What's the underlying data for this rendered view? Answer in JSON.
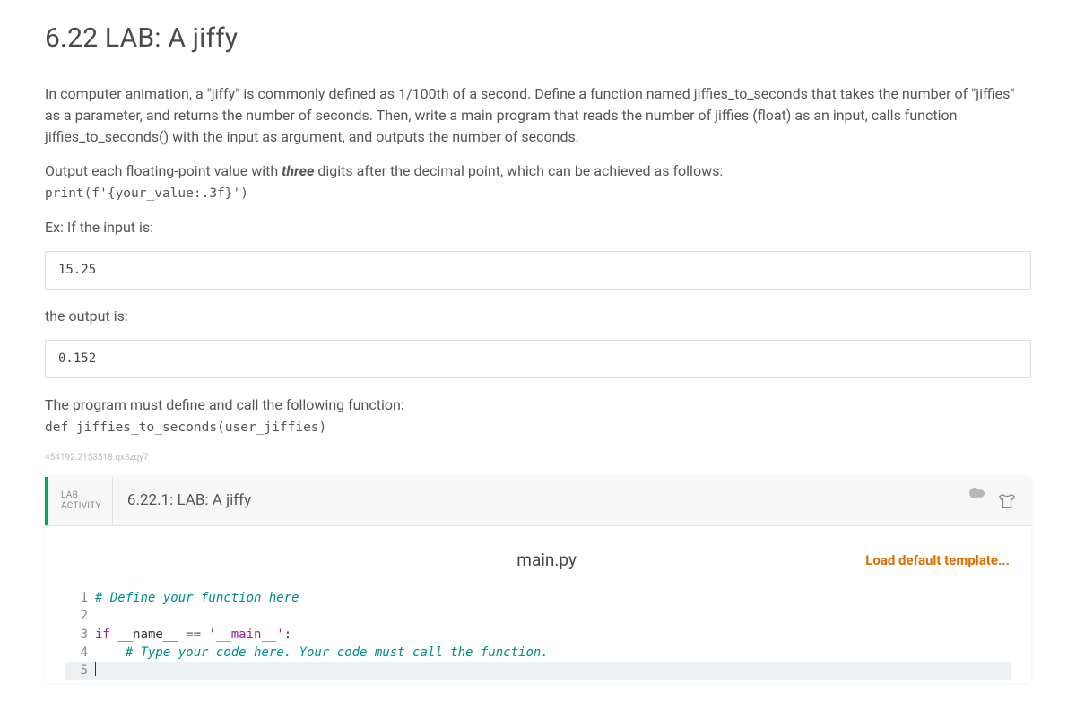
{
  "title": "6.22 LAB: A jiffy",
  "intro_html": "In computer animation, a \"jiffy\" is commonly defined as 1/100th of a second. Define a function named jiffies_to_seconds that takes the number of \"jiffies\" as a parameter, and returns the number of seconds. Then, write a main program that reads the number of jiffies (float) as an input, calls function jiffies_to_seconds() with the input as argument, and outputs the number of seconds.",
  "format_prefix": "Output each floating-point value with ",
  "format_emph": "three",
  "format_suffix": " digits after the decimal point, which can be achieved as follows:",
  "format_code": "print(f'{your_value:.3f}')",
  "ex_input_label": "Ex: If the input is:",
  "ex_input_value": "15.25",
  "ex_output_label": "the output is:",
  "ex_output_value": "0.152",
  "must_define_text": "The program must define and call the following function:",
  "must_define_code": "def jiffies_to_seconds(user_jiffies)",
  "watermark": "454192.2153518.qx3zqy7",
  "lab": {
    "badge_line1": "LAB",
    "badge_line2": "ACTIVITY",
    "title": "6.22.1: LAB: A jiffy"
  },
  "editor": {
    "filename": "main.py",
    "load_template": "Load default template...",
    "lines": {
      "l1_comment": "# Define your function here",
      "l3_kw": "if",
      "l3_name1": " __name__ ",
      "l3_eq": "==",
      "l3_str": " '__main__'",
      "l3_colon": ":",
      "l4_indent": "    ",
      "l4_comment": "# Type your code here. Your code must call the function."
    }
  }
}
